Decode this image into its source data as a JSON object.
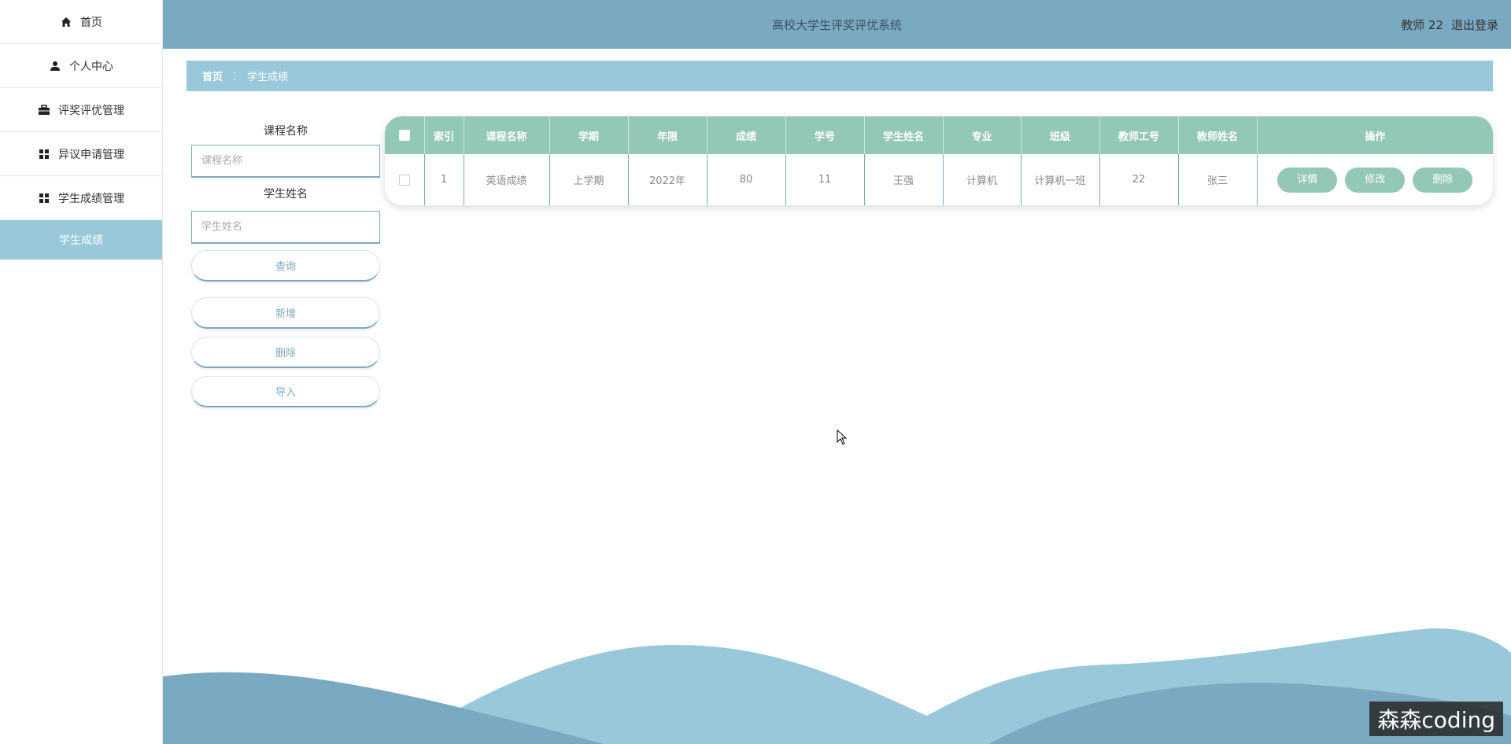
{
  "sidebar": {
    "items": [
      {
        "label": "首页",
        "icon": "home-icon"
      },
      {
        "label": "个人中心",
        "icon": "user-icon"
      },
      {
        "label": "评奖评优管理",
        "icon": "briefcase-icon"
      },
      {
        "label": "异议申请管理",
        "icon": "grid-icon"
      },
      {
        "label": "学生成绩管理",
        "icon": "grid-icon"
      }
    ],
    "subitem": "学生成绩"
  },
  "header": {
    "title": "高校大学生评奖评优系统",
    "user": "教师 22",
    "logout": "退出登录"
  },
  "breadcrumb": {
    "home": "首页",
    "current": "学生成绩"
  },
  "search": {
    "course_label": "课程名称",
    "course_placeholder": "课程名称",
    "student_label": "学生姓名",
    "student_placeholder": "学生姓名",
    "query": "查询",
    "add": "新增",
    "delete": "删除",
    "import": "导入"
  },
  "table": {
    "headers": [
      "索引",
      "课程名称",
      "学期",
      "年限",
      "成绩",
      "学号",
      "学生姓名",
      "专业",
      "班级",
      "教师工号",
      "教师姓名",
      "操作"
    ],
    "rows": [
      {
        "index": "1",
        "course": "英语成绩",
        "term": "上学期",
        "year": "2022年",
        "score": "80",
        "student_no": "11",
        "student_name": "王强",
        "major": "计算机",
        "class": "计算机一班",
        "teacher_no": "22",
        "teacher_name": "张三"
      }
    ],
    "actions": {
      "detail": "详情",
      "edit": "修改",
      "delete": "删除"
    }
  },
  "watermark": "森森coding",
  "colors": {
    "header": "#7aa9c2",
    "breadcrumb": "#98c8da",
    "table_header": "#93c8b5",
    "accent": "#7aa9c2"
  }
}
